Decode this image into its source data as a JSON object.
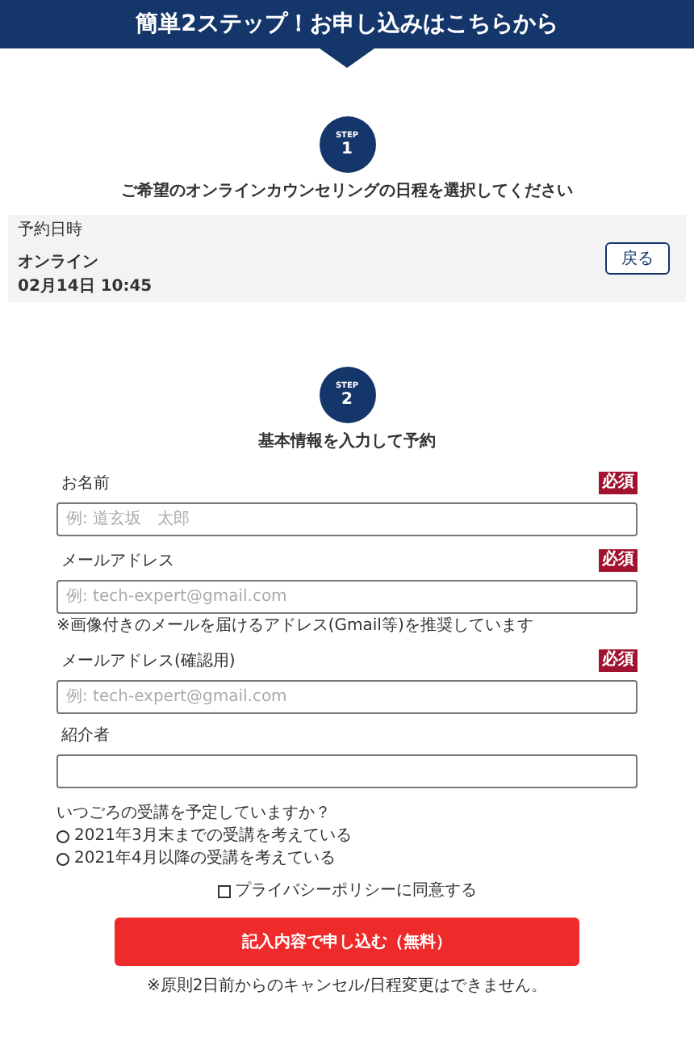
{
  "banner": {
    "title": "簡単2ステップ！お申し込みはこちらから"
  },
  "step1": {
    "label": "STEP",
    "number": "1",
    "title": "ご希望のオンラインカウンセリングの日程を選択してください"
  },
  "reservation": {
    "heading": "予約日時",
    "type": "オンライン",
    "datetime": "02月14日 10:45",
    "back_button": "戻る"
  },
  "step2": {
    "label": "STEP",
    "number": "2",
    "title": "基本情報を入力して予約"
  },
  "fields": [
    {
      "label": "お名前",
      "required": true,
      "required_badge": "必須",
      "placeholder": "例: 道玄坂　太郎"
    },
    {
      "label": "メールアドレス",
      "required": true,
      "required_badge": "必須",
      "placeholder": "例: tech-expert@gmail.com",
      "note": "※画像付きのメールを届けるアドレス(Gmail等)を推奨しています"
    },
    {
      "label": "メールアドレス(確認用)",
      "required": true,
      "required_badge": "必須",
      "placeholder": "例: tech-expert@gmail.com"
    },
    {
      "label": "紹介者",
      "required": false
    }
  ],
  "question": {
    "text": "いつごろの受講を予定していますか？",
    "options": [
      {
        "label": "2021年3月末までの受講を考えている",
        "selected": false
      },
      {
        "label": "2021年4月以降の受講を考えている",
        "selected": false
      }
    ]
  },
  "privacy": {
    "label": "プライバシーポリシーに同意する",
    "checked": false
  },
  "submit_button": "記入内容で申し込む（無料）",
  "footnote": "※原則2日前からのキャンセル/日程変更はできません。"
}
